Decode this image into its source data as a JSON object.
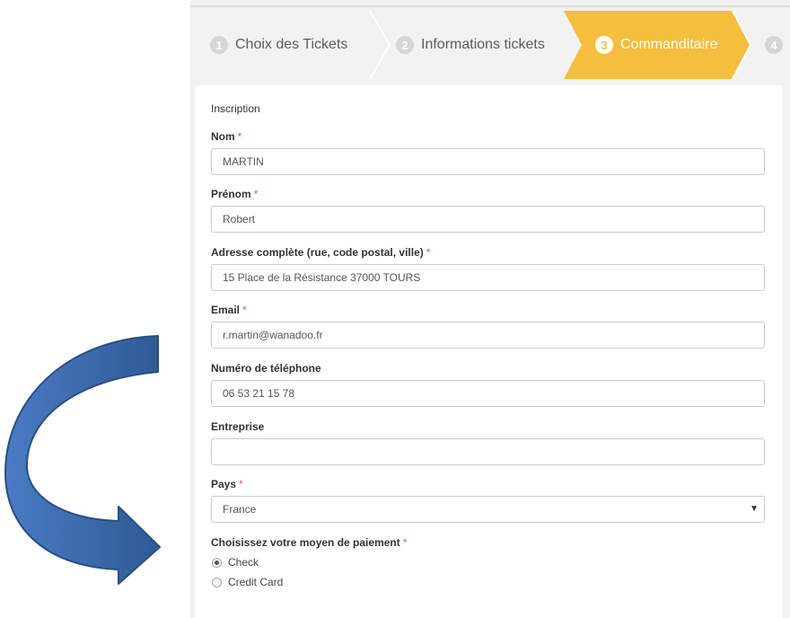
{
  "steps": [
    {
      "num": "1",
      "label": "Choix des Tickets",
      "active": false
    },
    {
      "num": "2",
      "label": "Informations tickets",
      "active": false
    },
    {
      "num": "3",
      "label": "Commanditaire",
      "active": true
    },
    {
      "num": "4",
      "label": "",
      "active": false
    }
  ],
  "colors": {
    "active_step": "#f5be3d",
    "arrow": "#3f6aa8",
    "required": "#e05555"
  },
  "form": {
    "section_title": "Inscription",
    "required_mark": "*",
    "fields": {
      "nom": {
        "label": "Nom",
        "value": "MARTIN"
      },
      "prenom": {
        "label": "Prénom",
        "value": "Robert"
      },
      "adresse": {
        "label": "Adresse complète (rue, code postal, ville)",
        "value": "15 Place de la Résistance 37000 TOURS"
      },
      "email": {
        "label": "Email",
        "value": "r.martin@wanadoo.fr"
      },
      "telephone": {
        "label": "Numéro de téléphone",
        "value": "06 53 21 15 78"
      },
      "entreprise": {
        "label": "Entreprise",
        "value": ""
      },
      "pays": {
        "label": "Pays",
        "value": "France"
      }
    },
    "payment": {
      "label": "Choisissez votre moyen de paiement",
      "options": [
        {
          "label": "Check",
          "selected": true
        },
        {
          "label": "Credit Card",
          "selected": false
        }
      ]
    }
  },
  "decoration": {
    "arrow_icon": "curved-arrow-icon"
  }
}
